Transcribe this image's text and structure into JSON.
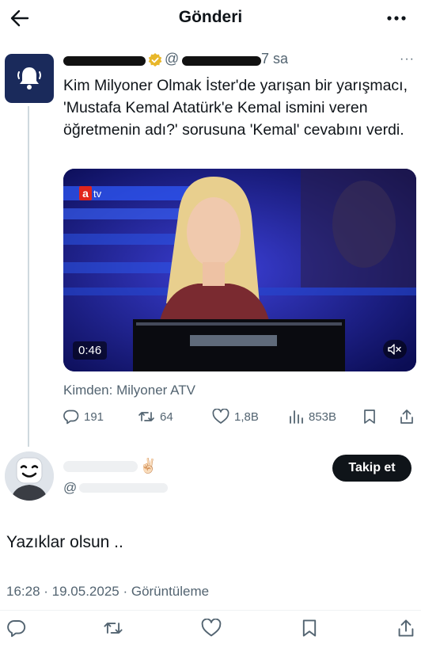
{
  "header": {
    "title": "Gönderi"
  },
  "quoted_post": {
    "handle_prefix": "@",
    "time": "7 sa",
    "text": "Kim Milyoner Olmak İster'de yarışan bir yarışmacı, 'Mustafa Kemal Atatürk'e Kemal ismini veren öğretmenin adı?' sorusuna 'Kemal' cevabını verdi.",
    "video": {
      "channel_logo_a": "a",
      "channel_logo_tv": "tv",
      "duration": "0:46"
    },
    "source": "Kimden: Milyoner ATV",
    "actions": {
      "replies": "191",
      "reposts": "64",
      "likes": "1,8B",
      "views": "853B"
    }
  },
  "reply_post": {
    "emoji": "✌🏻",
    "handle_prefix": "@",
    "follow_label": "Takip et",
    "text": "Yazıklar olsun ..",
    "meta": "16:28 · 19.05.2025 · Görüntüleme"
  },
  "colors": {
    "text": "#0f1419",
    "muted": "#536471",
    "verified_gold": "#e8b72a",
    "avatar_bg": "#1a2a5b",
    "follow_bg": "#0f1419"
  }
}
